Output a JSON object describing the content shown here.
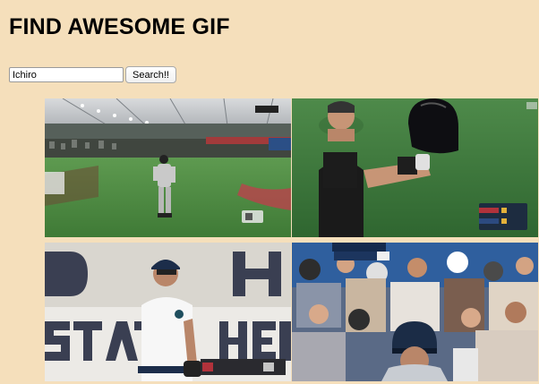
{
  "page": {
    "title": "FIND AWESOME GIF"
  },
  "search": {
    "value": "Ichiro",
    "button_label": "Search!!"
  },
  "gifs": [
    {
      "name": "gif-stadium-dome-outfielder"
    },
    {
      "name": "gif-player-raising-helmet"
    },
    {
      "name": "gif-mariners-player-batting-gloves"
    },
    {
      "name": "gif-player-in-crowd"
    }
  ],
  "colors": {
    "background": "#f5dfbb"
  }
}
